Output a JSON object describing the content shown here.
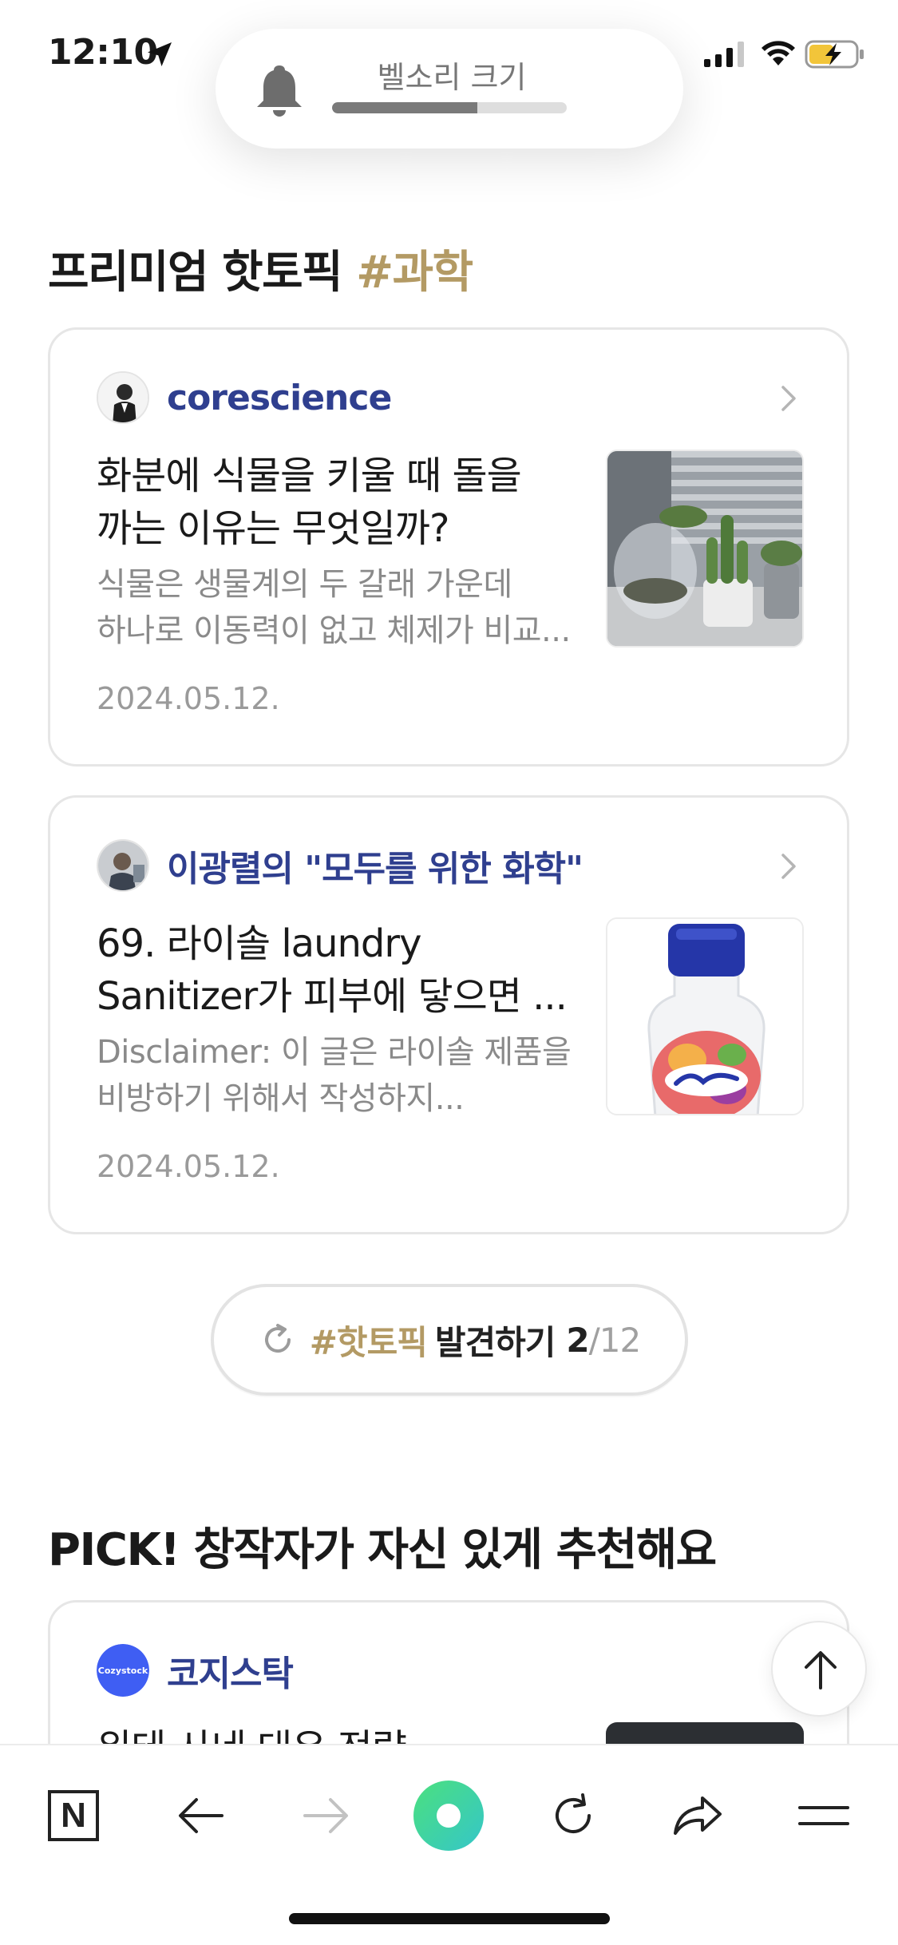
{
  "status_bar": {
    "time": "12:10"
  },
  "volume_hud": {
    "label": "벨소리 크기",
    "level": 0.62
  },
  "premium_section": {
    "title": "프리미엄 핫토픽",
    "hashtag": "#과학"
  },
  "cards": [
    {
      "author": "corescience",
      "title_lines": [
        "화분에 식물을 키울 때 돌을",
        "까는 이유는 무엇일까?"
      ],
      "excerpt_lines": [
        "식물은 생물계의 두 갈래 가운데",
        "하나로 이동력이 없고 체제가 비교..."
      ],
      "date": "2024.05.12."
    },
    {
      "author": "이광렬의 \"모두를 위한 화학\"",
      "title_lines": [
        "69. 라이솔 laundry",
        "Sanitizer가 피부에 닿으면 ..."
      ],
      "excerpt_lines": [
        "Disclaimer: 이 글은 라이솔 제품을",
        "비방하기 위해서 작성하지..."
      ],
      "date": "2024.05.12."
    }
  ],
  "discover": {
    "hashtag": "#핫토픽",
    "label": "발견하기",
    "current": "2",
    "total": "/12"
  },
  "pick_section": {
    "title": "PICK! 창작자가 자신 있게 추천해요",
    "card": {
      "author": "코지스탁",
      "author_logo": "Cozystock",
      "title_partial": "위테 사네 대우 전략"
    }
  },
  "toolbar": {
    "items": [
      "naver-home",
      "back",
      "forward",
      "green-dot",
      "reload",
      "share",
      "menu"
    ]
  },
  "colors": {
    "accent_gold": "#b39a64",
    "author_blue": "#2f3f8f"
  }
}
